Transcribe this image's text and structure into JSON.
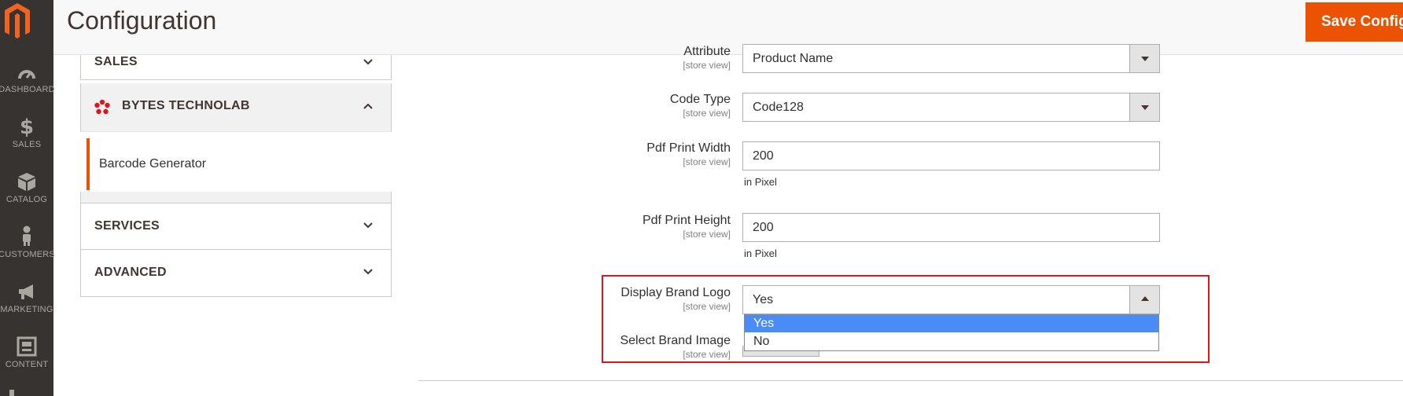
{
  "nav": {
    "items": [
      {
        "label": "DASHBOARD",
        "icon": "dashboard-icon"
      },
      {
        "label": "SALES",
        "icon": "dollar-icon"
      },
      {
        "label": "CATALOG",
        "icon": "box-icon"
      },
      {
        "label": "CUSTOMERS",
        "icon": "person-icon"
      },
      {
        "label": "MARKETING",
        "icon": "megaphone-icon"
      },
      {
        "label": "CONTENT",
        "icon": "content-icon"
      }
    ]
  },
  "header": {
    "title": "Configuration",
    "save_label": "Save Config"
  },
  "config_nav": {
    "sales": "SALES",
    "bytes": "BYTES TECHNOLAB",
    "barcode": "Barcode Generator",
    "services": "SERVICES",
    "advanced": "ADVANCED"
  },
  "form": {
    "attribute": {
      "label": "Attribute",
      "scope": "[store view]",
      "value": "Product Name"
    },
    "code_type": {
      "label": "Code Type",
      "scope": "[store view]",
      "value": "Code128"
    },
    "pdf_width": {
      "label": "Pdf Print Width",
      "scope": "[store view]",
      "value": "200",
      "note": "in Pixel"
    },
    "pdf_height": {
      "label": "Pdf Print Height",
      "scope": "[store view]",
      "value": "200",
      "note": "in Pixel"
    },
    "brand_logo": {
      "label": "Display Brand Logo",
      "scope": "[store view]",
      "value": "Yes",
      "options": [
        "Yes",
        "No"
      ]
    },
    "brand_image": {
      "label": "Select Brand Image",
      "scope": "[store view]"
    }
  },
  "colors": {
    "accent": "#eb5202",
    "highlight": "#e0151b",
    "selected_option": "#4a8cf7"
  }
}
